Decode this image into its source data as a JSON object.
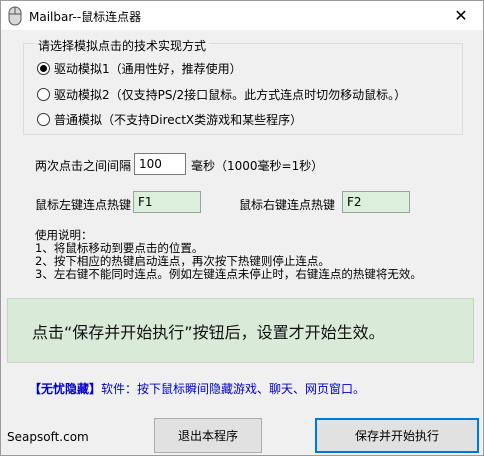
{
  "window": {
    "title": "Mailbar--鼠标连点器",
    "close_glyph": "✕"
  },
  "method_group": {
    "legend": "请选择模拟点击的技术实现方式",
    "options": [
      {
        "label": "驱动模拟1（通用性好，推荐使用）",
        "checked": true
      },
      {
        "label": "驱动模拟2（仅支持PS/2接口鼠标。此方式连点时切勿移动鼠标。）",
        "checked": false
      },
      {
        "label": "普通模拟（不支持DirectX类游戏和某些程序）",
        "checked": false
      }
    ]
  },
  "interval": {
    "label": "两次点击之间间隔",
    "value": "100",
    "unit": "毫秒（1000毫秒=1秒）"
  },
  "hotkeys": {
    "left_label": "鼠标左键连点热键",
    "left_value": "F1",
    "right_label": "鼠标右键连点热键",
    "right_value": "F2"
  },
  "help": {
    "title": "使用说明：",
    "lines": [
      "1、将鼠标移动到要点击的位置。",
      "2、按下相应的热键启动连点，再次按下热键则停止连点。",
      "3、左右键不能同时连点。例如左键连点未停止时，右键连点的热键将无效。"
    ]
  },
  "banner": {
    "text": "点击“保存并开始执行”按钮后，设置才开始生效。"
  },
  "ad": {
    "tag": "【无忧隐藏】",
    "text": "软件：按下鼠标瞬间隐藏游戏、聊天、网页窗口。"
  },
  "footer": {
    "site": "Seapsoft.com",
    "exit_label": "退出本程序",
    "save_label": "保存并开始执行"
  },
  "colors": {
    "banner_bg": "#d9ebd8",
    "hotkey_bg": "#dcefdc",
    "link": "#0000cc",
    "focus_border": "#0078d7"
  }
}
